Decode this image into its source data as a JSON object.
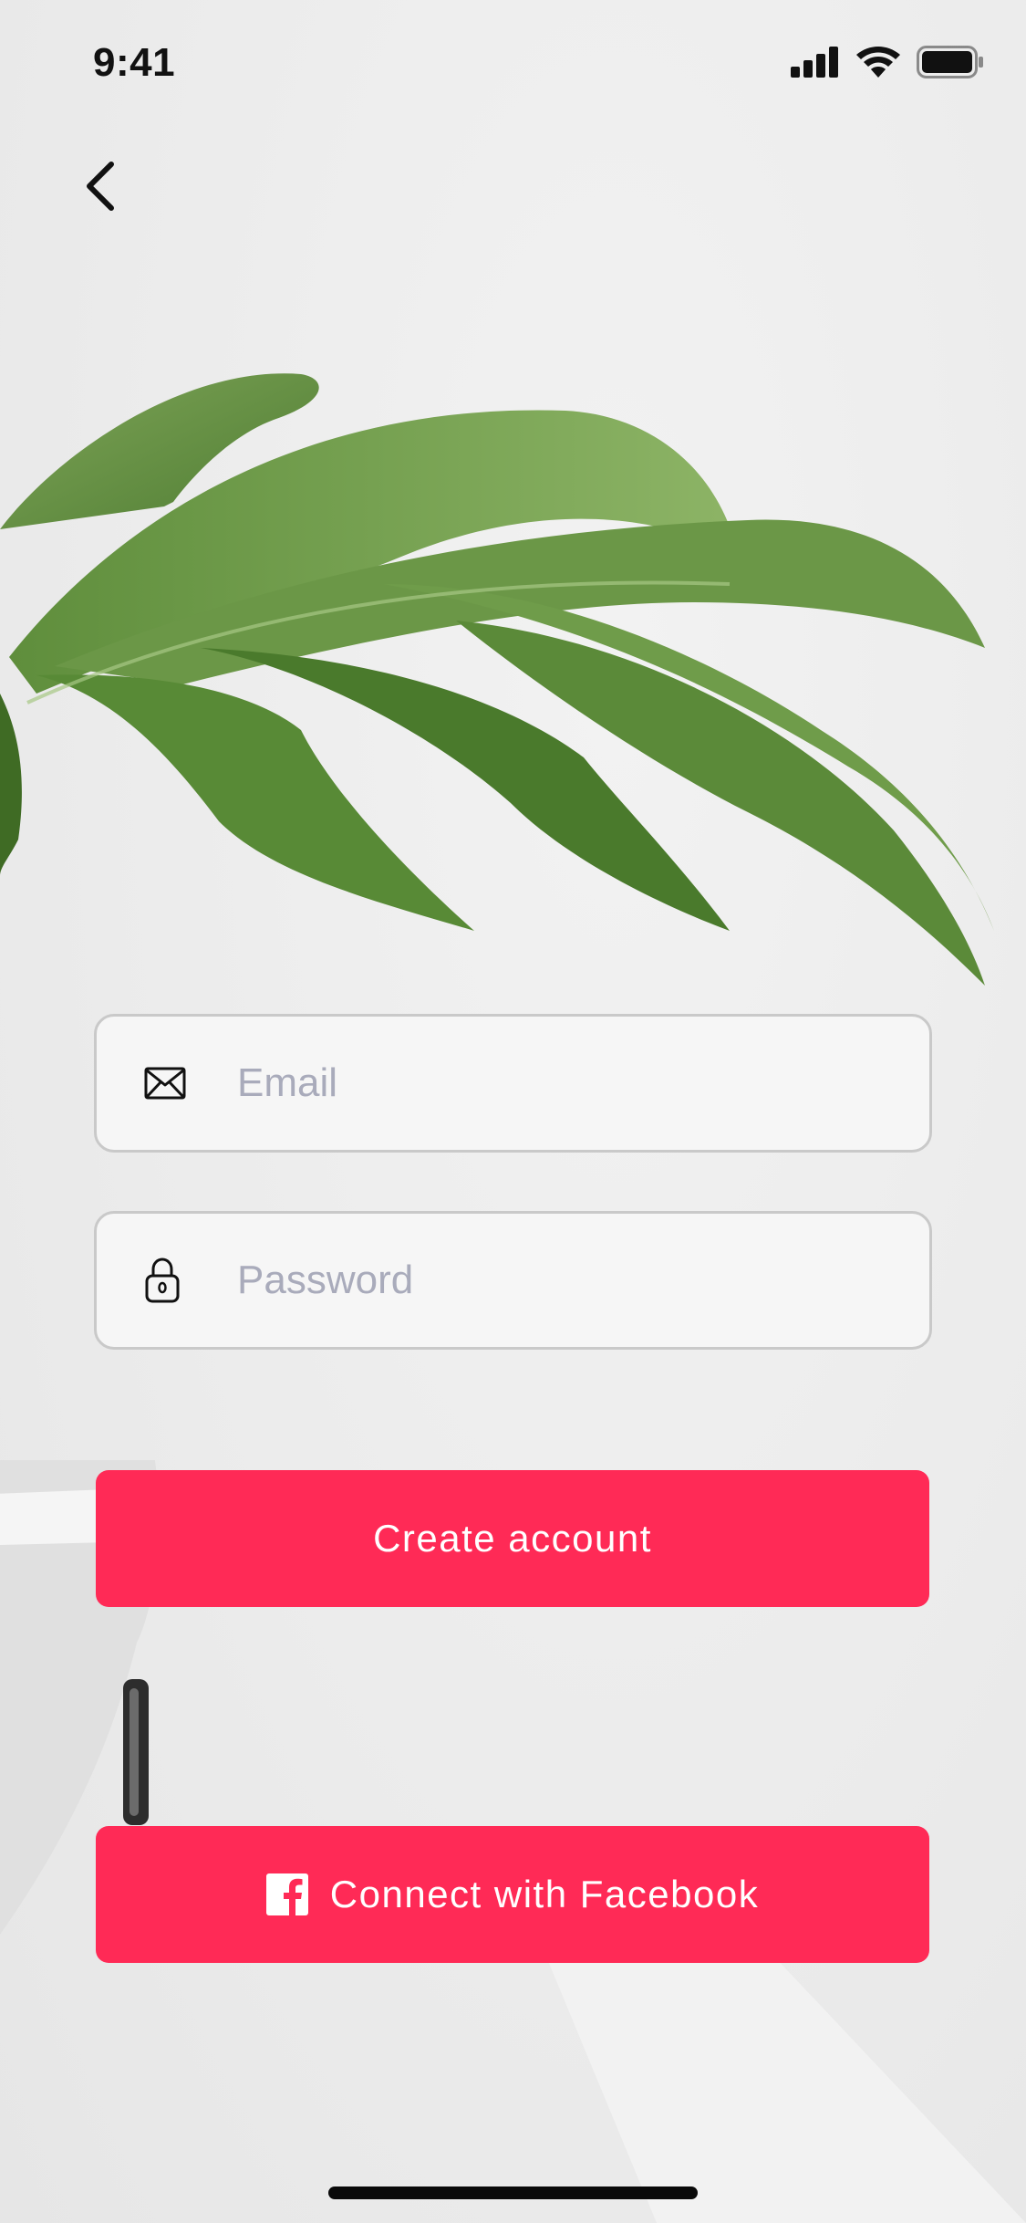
{
  "status_bar": {
    "time": "9:41",
    "icons": [
      "signal-icon",
      "wifi-icon",
      "battery-icon"
    ]
  },
  "nav": {
    "back_icon": "chevron-left-icon"
  },
  "form": {
    "email": {
      "icon": "envelope-icon",
      "placeholder": "Email",
      "value": ""
    },
    "password": {
      "icon": "lock-icon",
      "placeholder": "Password",
      "value": ""
    }
  },
  "actions": {
    "create_account_label": "Create account",
    "facebook_label": "Connect with Facebook",
    "facebook_icon": "facebook-icon"
  },
  "colors": {
    "accent": "#ff2a56",
    "placeholder": "#a9abbb",
    "field_border": "#c9c9c9"
  }
}
